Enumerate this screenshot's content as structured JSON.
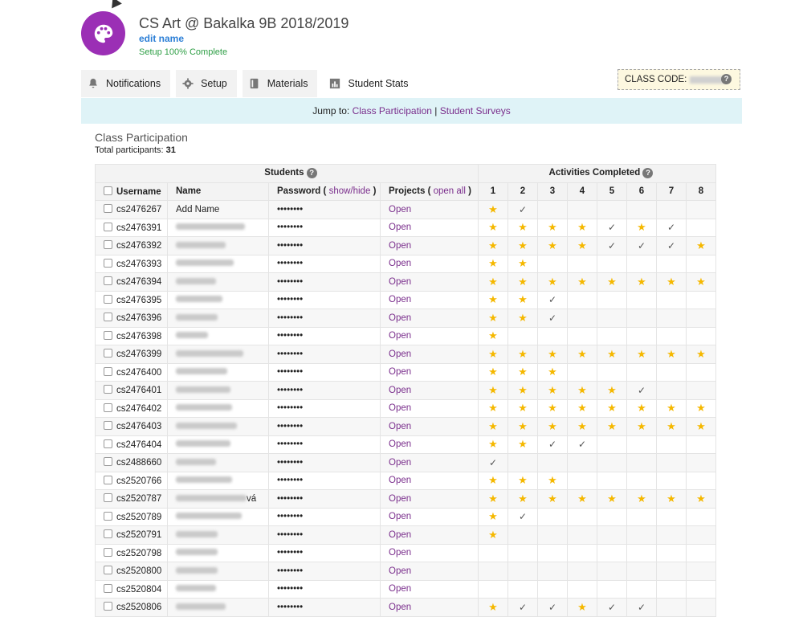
{
  "header": {
    "title": "CS Art @ Bakalka 9B 2018/2019",
    "edit_label": "edit name",
    "setup_status": "Setup 100% Complete",
    "avatar_icon": "palette-icon"
  },
  "tabs": [
    {
      "label": "Notifications",
      "icon": "bell-icon"
    },
    {
      "label": "Setup",
      "icon": "gear-icon"
    },
    {
      "label": "Materials",
      "icon": "book-icon"
    },
    {
      "label": "Student Stats",
      "icon": "bar-chart-icon",
      "active": true
    }
  ],
  "class_code": {
    "label": "CLASS CODE:"
  },
  "jump": {
    "prefix": "Jump to:",
    "link1": "Class Participation",
    "separator": "|",
    "link2": "Student Surveys"
  },
  "participation": {
    "title": "Class Participation",
    "total_label": "Total participants:",
    "total_value": "31"
  },
  "table": {
    "group_students": "Students",
    "group_activities": "Activities Completed",
    "col_username": "Username",
    "col_name": "Name",
    "col_password": "Password (",
    "col_password_link": "show/hide",
    "col_password_end": ")",
    "col_projects": "Projects (",
    "col_projects_link": "open all",
    "col_projects_end": ")",
    "activity_numbers": [
      "1",
      "2",
      "3",
      "4",
      "5",
      "6",
      "7",
      "8"
    ],
    "rows": [
      {
        "username": "cs2476267",
        "name": "Add Name",
        "password": "••••••••",
        "project": "Open",
        "acts": [
          "s",
          "c",
          "",
          "",
          "",
          "",
          "",
          ""
        ]
      },
      {
        "username": "cs2476391",
        "name": "",
        "password": "••••••••",
        "project": "Open",
        "acts": [
          "s",
          "s",
          "s",
          "s",
          "c",
          "s",
          "c",
          ""
        ]
      },
      {
        "username": "cs2476392",
        "name": "",
        "password": "••••••••",
        "project": "Open",
        "acts": [
          "s",
          "s",
          "s",
          "s",
          "c",
          "c",
          "c",
          "s"
        ]
      },
      {
        "username": "cs2476393",
        "name": "",
        "password": "••••••••",
        "project": "Open",
        "acts": [
          "s",
          "s",
          "",
          "",
          "",
          "",
          "",
          ""
        ]
      },
      {
        "username": "cs2476394",
        "name": "",
        "password": "••••••••",
        "project": "Open",
        "acts": [
          "s",
          "s",
          "s",
          "s",
          "s",
          "s",
          "s",
          "s"
        ]
      },
      {
        "username": "cs2476395",
        "name": "",
        "password": "••••••••",
        "project": "Open",
        "acts": [
          "s",
          "s",
          "c",
          "",
          "",
          "",
          "",
          ""
        ]
      },
      {
        "username": "cs2476396",
        "name": "",
        "password": "••••••••",
        "project": "Open",
        "acts": [
          "s",
          "s",
          "c",
          "",
          "",
          "",
          "",
          ""
        ]
      },
      {
        "username": "cs2476398",
        "name": "",
        "password": "••••••••",
        "project": "Open",
        "acts": [
          "s",
          "",
          "",
          "",
          "",
          "",
          "",
          ""
        ]
      },
      {
        "username": "cs2476399",
        "name": "",
        "password": "••••••••",
        "project": "Open",
        "acts": [
          "s",
          "s",
          "s",
          "s",
          "s",
          "s",
          "s",
          "s"
        ]
      },
      {
        "username": "cs2476400",
        "name": "",
        "password": "••••••••",
        "project": "Open",
        "acts": [
          "s",
          "s",
          "s",
          "",
          "",
          "",
          "",
          ""
        ]
      },
      {
        "username": "cs2476401",
        "name": "",
        "password": "••••••••",
        "project": "Open",
        "acts": [
          "s",
          "s",
          "s",
          "s",
          "s",
          "c",
          "",
          ""
        ]
      },
      {
        "username": "cs2476402",
        "name": "",
        "password": "••••••••",
        "project": "Open",
        "acts": [
          "s",
          "s",
          "s",
          "s",
          "s",
          "s",
          "s",
          "s"
        ]
      },
      {
        "username": "cs2476403",
        "name": "",
        "password": "••••••••",
        "project": "Open",
        "acts": [
          "s",
          "s",
          "s",
          "s",
          "s",
          "s",
          "s",
          "s"
        ]
      },
      {
        "username": "cs2476404",
        "name": "",
        "password": "••••••••",
        "project": "Open",
        "acts": [
          "s",
          "s",
          "c",
          "c",
          "",
          "",
          "",
          ""
        ]
      },
      {
        "username": "cs2488660",
        "name": "",
        "password": "••••••••",
        "project": "Open",
        "acts": [
          "c",
          "",
          "",
          "",
          "",
          "",
          "",
          ""
        ]
      },
      {
        "username": "cs2520766",
        "name": "",
        "password": "••••••••",
        "project": "Open",
        "acts": [
          "s",
          "s",
          "s",
          "",
          "",
          "",
          "",
          ""
        ]
      },
      {
        "username": "cs2520787",
        "name": "vá",
        "password": "••••••••",
        "project": "Open",
        "acts": [
          "s",
          "s",
          "s",
          "s",
          "s",
          "s",
          "s",
          "s"
        ]
      },
      {
        "username": "cs2520789",
        "name": "",
        "password": "••••••••",
        "project": "Open",
        "acts": [
          "s",
          "c",
          "",
          "",
          "",
          "",
          "",
          ""
        ]
      },
      {
        "username": "cs2520791",
        "name": "",
        "password": "••••••••",
        "project": "Open",
        "acts": [
          "s",
          "",
          "",
          "",
          "",
          "",
          "",
          ""
        ]
      },
      {
        "username": "cs2520798",
        "name": "",
        "password": "••••••••",
        "project": "Open",
        "acts": [
          "",
          "",
          "",
          "",
          "",
          "",
          "",
          ""
        ]
      },
      {
        "username": "cs2520800",
        "name": "",
        "password": "••••••••",
        "project": "Open",
        "acts": [
          "",
          "",
          "",
          "",
          "",
          "",
          "",
          ""
        ]
      },
      {
        "username": "cs2520804",
        "name": "",
        "password": "••••••••",
        "project": "Open",
        "acts": [
          "",
          "",
          "",
          "",
          "",
          "",
          "",
          ""
        ]
      },
      {
        "username": "cs2520806",
        "name": "",
        "password": "••••••••",
        "project": "Open",
        "acts": [
          "s",
          "c",
          "c",
          "s",
          "c",
          "c",
          "",
          ""
        ]
      }
    ]
  }
}
